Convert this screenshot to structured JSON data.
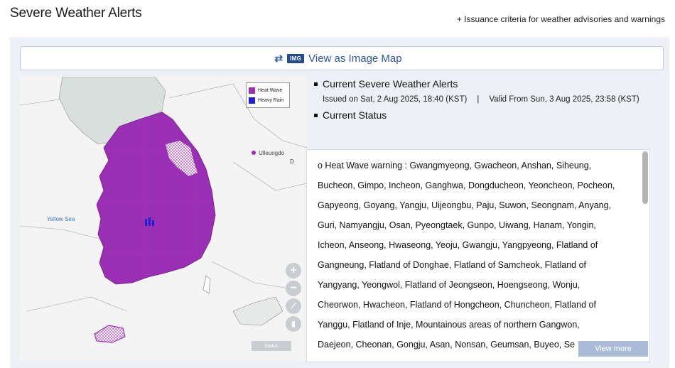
{
  "header": {
    "title": "Severe Weather Alerts",
    "criteria_link": "+ Issuance criteria for weather advisories and warnings"
  },
  "image_map_button": {
    "badge": "IMG",
    "label": "View as Image Map"
  },
  "map": {
    "legend": [
      {
        "label": "Heat Wave",
        "color": "#9b2fb5"
      },
      {
        "label": "Heavy Rain",
        "color": "#1f1fd6"
      }
    ],
    "labels": {
      "yellow_sea": "Yellow Sea",
      "ulleungdo": "Ulleungdo",
      "dokdo": "D"
    },
    "zoom_in": "+",
    "zoom_out": "−",
    "scale": "Status"
  },
  "alerts": {
    "current_title": "Current Severe Weather Alerts",
    "issued": "Issued on Sat, 2 Aug 2025, 18:40 (KST)",
    "separator": "|",
    "valid_from": "Valid From Sun, 3 Aug 2025, 23:58 (KST)",
    "status_title": "Current Status",
    "lines": [
      "o Heat Wave warning : Gwangmyeong, Gwacheon, Anshan, Siheung,",
      "Bucheon, Gimpo, Incheon, Ganghwa, Dongducheon, Yeoncheon, Pocheon,",
      "Gapyeong, Goyang, Yangju, Uijeongbu, Paju, Suwon, Seongnam, Anyang,",
      "Guri, Namyangju, Osan, Pyeongtaek, Gunpo, Uiwang, Hanam, Yongin,",
      "Icheon, Anseong, Hwaseong, Yeoju, Gwangju, Yangpyeong, Flatland of",
      "Gangneung, Flatland of Donghae, Flatland of Samcheok, Flatland of",
      "Yangyang, Yeongwol, Flatland of Jeongseon, Hoengseong, Wonju,",
      "Cheorwon, Hwacheon, Flatland of Hongcheon, Chuncheon, Flatland of",
      "Yanggu, Flatland of Inje, Mountainous areas of northern Gangwon,",
      "Daejeon, Cheonan, Gongju, Asan, Nonsan, Geumsan, Buyeo, Se"
    ],
    "view_more": "View more"
  },
  "colors": {
    "panel_bg": "#edf1f6",
    "heat_wave": "#9b2fb5",
    "heavy_rain": "#1f1fd6",
    "link_blue": "#2d58a6",
    "view_more_bg": "#a9bbd6"
  }
}
